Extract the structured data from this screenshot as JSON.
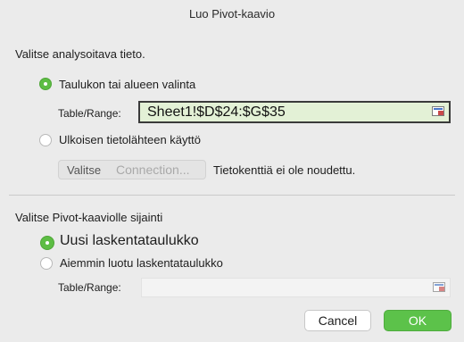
{
  "dialog": {
    "title": "Luo Pivot-kaavio"
  },
  "data_section": {
    "heading": "Valitse analysoitava tieto.",
    "option_table_label": "Taulukon tai alueen valinta",
    "option_table_selected": true,
    "range_label": "Table/Range:",
    "range_value": "Sheet1!$D$24:$G$35",
    "option_external_label": "Ulkoisen tietolähteen käyttö",
    "option_external_selected": false,
    "choose_label": "Valitse",
    "connection_label": "Connection...",
    "no_fields_text": "Tietokenttiä ei ole noudettu."
  },
  "location_section": {
    "heading": "Valitse Pivot-kaaviolle sijainti",
    "option_new_label": "Uusi laskentataulukko",
    "option_new_selected": true,
    "option_existing_label": "Aiemmin luotu laskentataulukko",
    "option_existing_selected": false,
    "range_label": "Table/Range:",
    "range_value": ""
  },
  "buttons": {
    "cancel_label": "Cancel",
    "ok_label": "OK"
  },
  "colors": {
    "accent_green": "#5cc24a",
    "range_highlight": "#e3f1d6",
    "dialog_bg": "#ebebeb"
  }
}
